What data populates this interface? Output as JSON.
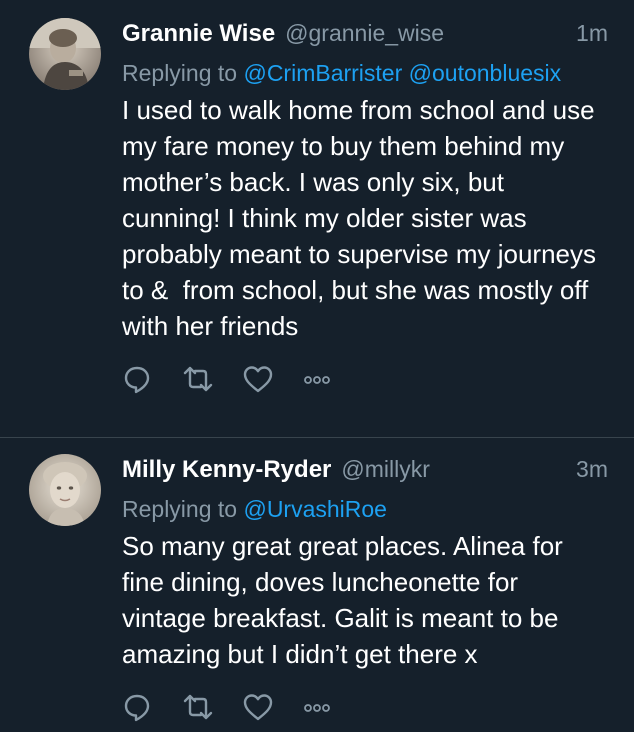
{
  "tweets": [
    {
      "name": "Grannie Wise",
      "handle": "@grannie_wise",
      "time": "1m",
      "replying_prefix": "Replying to",
      "mentions": [
        "@CrimBarrister",
        "@outonbluesix"
      ],
      "text": "I used to walk home from school and use my fare money to buy them behind my mother’s back. I was only six, but cunning! I think my older sister was probably meant to supervise my journeys to &  from school, but she was mostly off with her friends",
      "actions": [
        "reply-icon",
        "retweet-icon",
        "like-icon",
        "more-icon"
      ]
    },
    {
      "name": "Milly Kenny-Ryder",
      "handle": "@millykr",
      "time": "3m",
      "replying_prefix": "Replying to",
      "mentions": [
        "@UrvashiRoe"
      ],
      "text": "So many great great places. Alinea for fine dining, doves luncheonette for vintage breakfast. Galit is meant to be amazing but I didn’t get there x",
      "actions": [
        "reply-icon",
        "retweet-icon",
        "like-icon",
        "more-icon"
      ]
    }
  ],
  "colors": {
    "background": "#15202b",
    "divider": "#38444d",
    "secondary_text": "#8899a6",
    "link": "#1da1f2",
    "primary_text": "#ffffff"
  }
}
